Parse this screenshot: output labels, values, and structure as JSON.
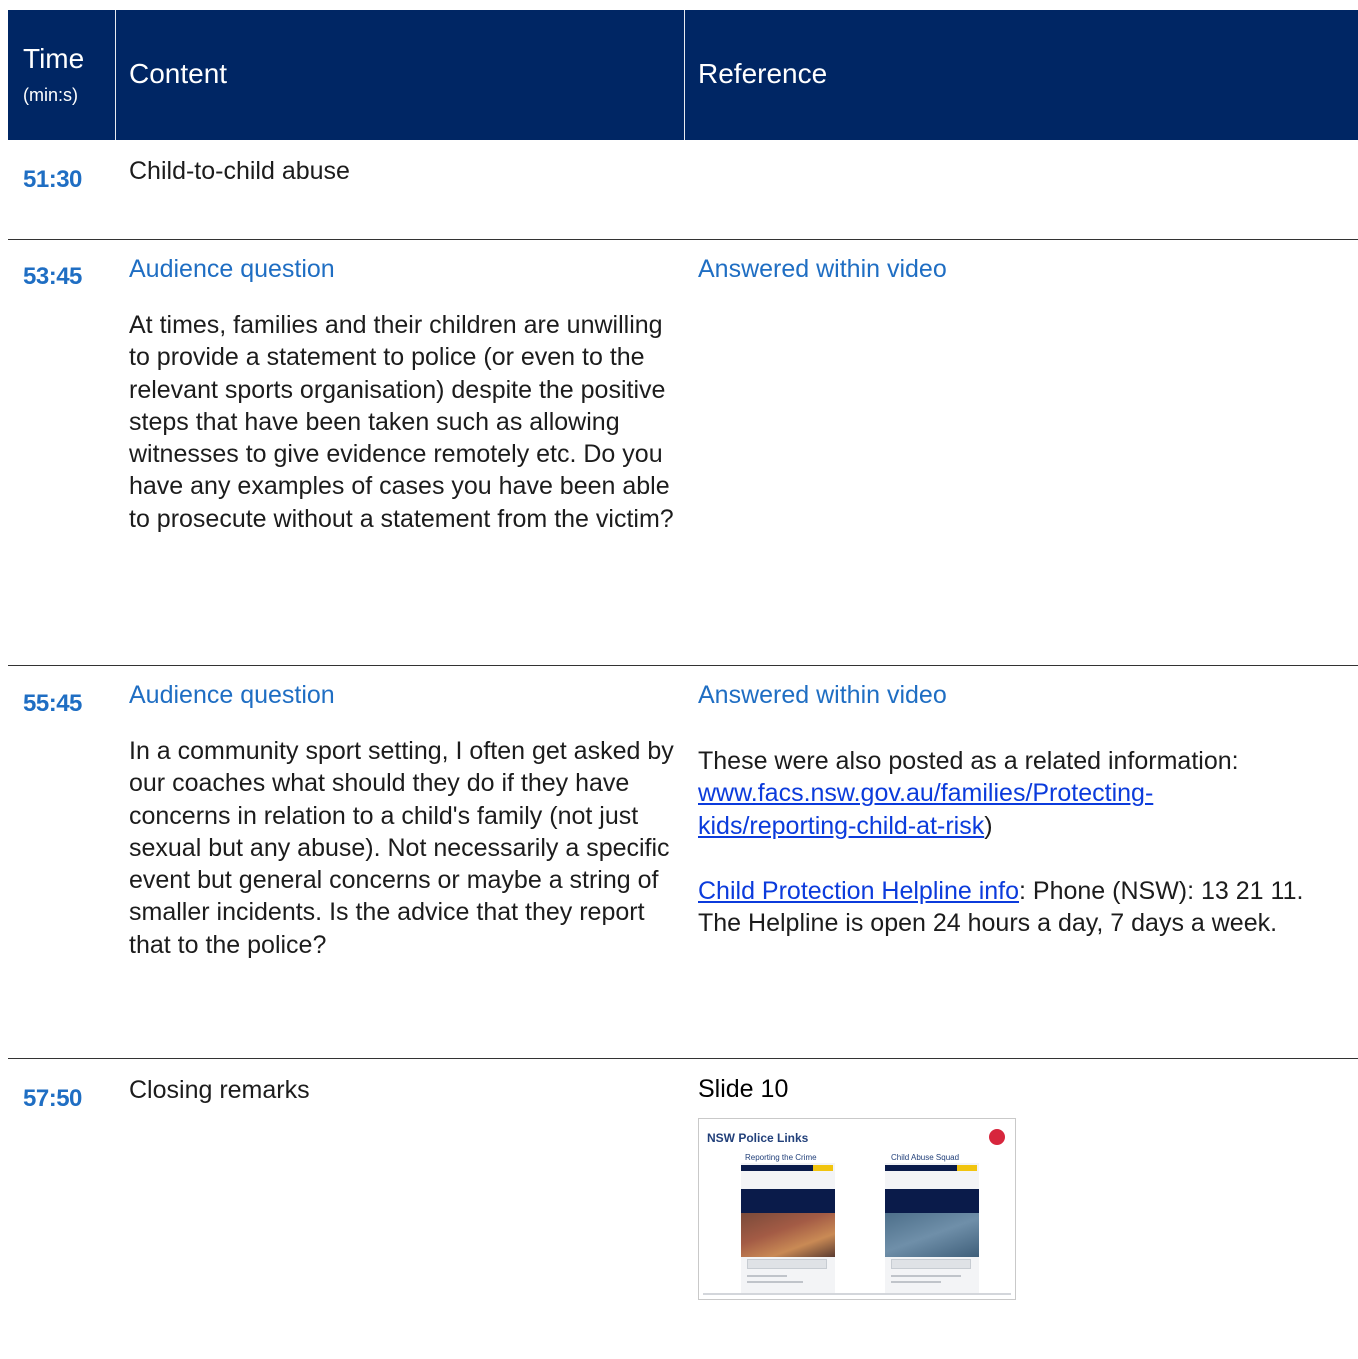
{
  "header": {
    "time_label": "Time",
    "time_sub": "(min:s)",
    "content_label": "Content",
    "reference_label": "Reference"
  },
  "rows": [
    {
      "time": "51:30",
      "content_title": "Child-to-child abuse"
    },
    {
      "time": "53:45",
      "content_title": "Audience question",
      "content_text": "At times, families and their children are unwilling to provide a statement to police (or even to the relevant sports organisation) despite the positive steps that have been taken such as allowing witnesses to give evidence remotely etc.  Do you have any examples of cases you have been able to prosecute without a statement from the victim?",
      "reference_title": "Answered within video"
    },
    {
      "time": "55:45",
      "content_title": "Audience question",
      "content_text": "In a community sport setting, I often get asked by our coaches what should they do if they have concerns in relation to a child's family (not just sexual but any abuse). Not necessarily a specific event but general concerns or maybe a string of smaller incidents. Is the advice that they report that to the police?",
      "reference_title": "Answered within video",
      "reference_text_1": "These were also posted as a related information:",
      "reference_link_1": "www.facs.nsw.gov.au/families/Protecting-kids/reporting-child-at-risk",
      "reference_link_1_suffix": ")",
      "reference_link_2": "Child Protection Helpline info",
      "reference_text_2": ": Phone (NSW): 13 21 11. The Helpline is open 24 hours a day, 7 days a week."
    },
    {
      "time": "57:50",
      "content_title": "Closing remarks",
      "reference_title": "Slide 10",
      "slide": {
        "title": "NSW Police Links",
        "card_1_title": "Reporting the Crime",
        "card_2_title": "Child Abuse Squad"
      }
    }
  ],
  "colors": {
    "header_bg": "#002664",
    "accent_blue": "#1f6ec3",
    "link_blue": "#0b3bdc"
  }
}
